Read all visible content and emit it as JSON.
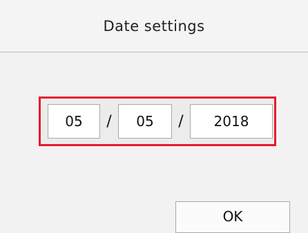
{
  "header": {
    "title": "Date settings"
  },
  "date": {
    "month": "05",
    "separator_1": "/",
    "day": "05",
    "separator_2": "/",
    "year": "2018"
  },
  "actions": {
    "ok_label": "OK"
  },
  "colors": {
    "selection_border": "#e8192c",
    "background": "#f2f2f2"
  }
}
